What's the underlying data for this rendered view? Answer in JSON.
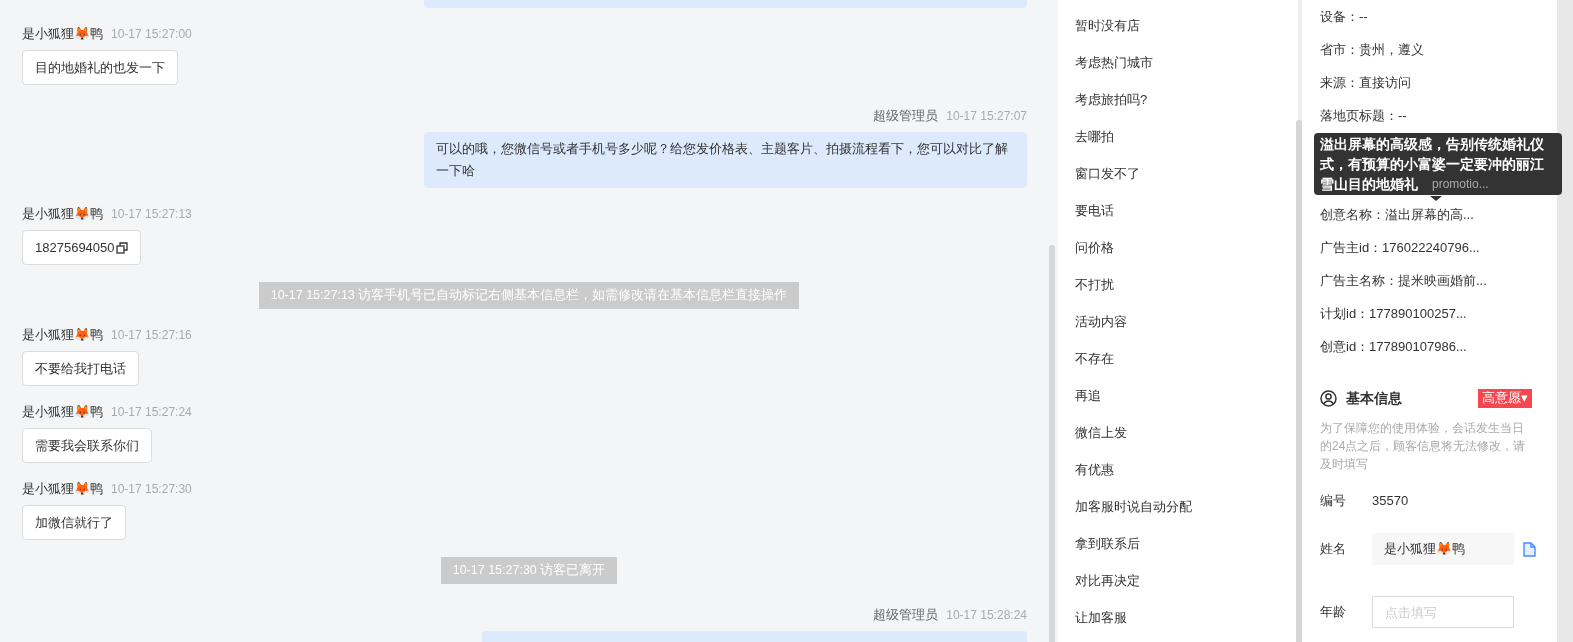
{
  "chat": {
    "messages": [
      {
        "kind": "agent_cut"
      },
      {
        "kind": "visitor",
        "sender": "是小狐狸🦊鸭",
        "time": "10-17 15:27:00",
        "text": "目的地婚礼的也发一下"
      },
      {
        "kind": "agent",
        "sender": "超级管理员",
        "time": "10-17 15:27:07",
        "text": "可以的哦，您微信号或者手机号多少呢？给您发价格表、主题客片、拍摄流程看下，您可以对比了解一下哈"
      },
      {
        "kind": "visitor",
        "sender": "是小狐狸🦊鸭",
        "time": "10-17 15:27:13",
        "text": "18275694050",
        "copyable": true
      },
      {
        "kind": "system",
        "text": "10-17 15:27:13 访客手机号已自动标记右侧基本信息栏，如需修改请在基本信息栏直接操作"
      },
      {
        "kind": "visitor",
        "sender": "是小狐狸🦊鸭",
        "time": "10-17 15:27:16",
        "text": "不要给我打电话"
      },
      {
        "kind": "visitor",
        "sender": "是小狐狸🦊鸭",
        "time": "10-17 15:27:24",
        "text": "需要我会联系你们"
      },
      {
        "kind": "visitor",
        "sender": "是小狐狸🦊鸭",
        "time": "10-17 15:27:30",
        "text": "加微信就行了"
      },
      {
        "kind": "system",
        "text": "10-17 15:27:30 访客已离开"
      },
      {
        "kind": "agent_bottom",
        "sender": "超级管理员",
        "time": "10-17 15:28:24"
      }
    ]
  },
  "quick_replies": [
    "暂时没有店",
    "考虑热门城市",
    "考虑旅拍吗?",
    "去哪拍",
    "窗口发不了",
    "要电话",
    "问价格",
    "不打扰",
    "活动内容",
    "不存在",
    "再追",
    "微信上发",
    "有优惠",
    "加客服时说自动分配",
    "拿到联系后",
    "对比再决定",
    "让加客服"
  ],
  "visitor_info": {
    "rows": [
      "设备：--",
      "省市：贵州，遵义",
      "来源：直接访问",
      "落地页标题：--",
      null,
      null,
      "创意名称：溢出屏幕的高...",
      "广告主id：176022240796...",
      "广告主名称：提米映画婚前...",
      "计划id：177890100257...",
      "创意id：177890107986..."
    ],
    "tooltip": "溢出屏幕的高级感，告别传统婚礼仪式，有预算的小富婆一定要冲的丽江雪山目的地婚礼",
    "tooltip_peek": "promotio...",
    "section_title": "基本信息",
    "intent_badge": "高意愿▾",
    "note": "为了保障您的使用体验，会话发生当日的24点之后，顾客信息将无法修改，请及时填写",
    "fields": [
      {
        "kind": "static",
        "label": "编号",
        "value": "35570"
      },
      {
        "kind": "text",
        "label": "姓名",
        "value": "是小狐狸🦊鸭"
      },
      {
        "kind": "input",
        "label": "年龄",
        "placeholder": "点击填写"
      }
    ]
  }
}
